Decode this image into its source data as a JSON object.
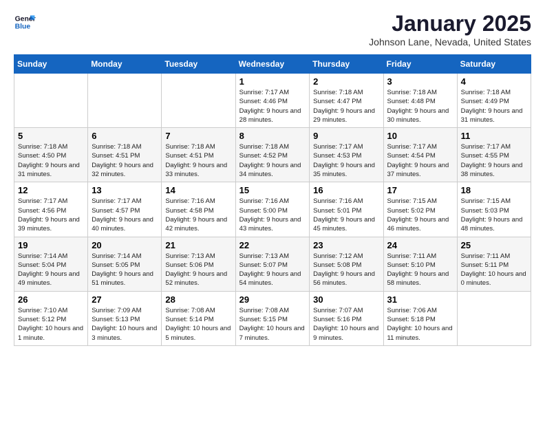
{
  "header": {
    "logo_line1": "General",
    "logo_line2": "Blue",
    "month": "January 2025",
    "location": "Johnson Lane, Nevada, United States"
  },
  "weekdays": [
    "Sunday",
    "Monday",
    "Tuesday",
    "Wednesday",
    "Thursday",
    "Friday",
    "Saturday"
  ],
  "weeks": [
    [
      {
        "day": "",
        "sunrise": "",
        "sunset": "",
        "daylight": ""
      },
      {
        "day": "",
        "sunrise": "",
        "sunset": "",
        "daylight": ""
      },
      {
        "day": "",
        "sunrise": "",
        "sunset": "",
        "daylight": ""
      },
      {
        "day": "1",
        "sunrise": "Sunrise: 7:17 AM",
        "sunset": "Sunset: 4:46 PM",
        "daylight": "Daylight: 9 hours and 28 minutes."
      },
      {
        "day": "2",
        "sunrise": "Sunrise: 7:18 AM",
        "sunset": "Sunset: 4:47 PM",
        "daylight": "Daylight: 9 hours and 29 minutes."
      },
      {
        "day": "3",
        "sunrise": "Sunrise: 7:18 AM",
        "sunset": "Sunset: 4:48 PM",
        "daylight": "Daylight: 9 hours and 30 minutes."
      },
      {
        "day": "4",
        "sunrise": "Sunrise: 7:18 AM",
        "sunset": "Sunset: 4:49 PM",
        "daylight": "Daylight: 9 hours and 31 minutes."
      }
    ],
    [
      {
        "day": "5",
        "sunrise": "Sunrise: 7:18 AM",
        "sunset": "Sunset: 4:50 PM",
        "daylight": "Daylight: 9 hours and 31 minutes."
      },
      {
        "day": "6",
        "sunrise": "Sunrise: 7:18 AM",
        "sunset": "Sunset: 4:51 PM",
        "daylight": "Daylight: 9 hours and 32 minutes."
      },
      {
        "day": "7",
        "sunrise": "Sunrise: 7:18 AM",
        "sunset": "Sunset: 4:51 PM",
        "daylight": "Daylight: 9 hours and 33 minutes."
      },
      {
        "day": "8",
        "sunrise": "Sunrise: 7:18 AM",
        "sunset": "Sunset: 4:52 PM",
        "daylight": "Daylight: 9 hours and 34 minutes."
      },
      {
        "day": "9",
        "sunrise": "Sunrise: 7:17 AM",
        "sunset": "Sunset: 4:53 PM",
        "daylight": "Daylight: 9 hours and 35 minutes."
      },
      {
        "day": "10",
        "sunrise": "Sunrise: 7:17 AM",
        "sunset": "Sunset: 4:54 PM",
        "daylight": "Daylight: 9 hours and 37 minutes."
      },
      {
        "day": "11",
        "sunrise": "Sunrise: 7:17 AM",
        "sunset": "Sunset: 4:55 PM",
        "daylight": "Daylight: 9 hours and 38 minutes."
      }
    ],
    [
      {
        "day": "12",
        "sunrise": "Sunrise: 7:17 AM",
        "sunset": "Sunset: 4:56 PM",
        "daylight": "Daylight: 9 hours and 39 minutes."
      },
      {
        "day": "13",
        "sunrise": "Sunrise: 7:17 AM",
        "sunset": "Sunset: 4:57 PM",
        "daylight": "Daylight: 9 hours and 40 minutes."
      },
      {
        "day": "14",
        "sunrise": "Sunrise: 7:16 AM",
        "sunset": "Sunset: 4:58 PM",
        "daylight": "Daylight: 9 hours and 42 minutes."
      },
      {
        "day": "15",
        "sunrise": "Sunrise: 7:16 AM",
        "sunset": "Sunset: 5:00 PM",
        "daylight": "Daylight: 9 hours and 43 minutes."
      },
      {
        "day": "16",
        "sunrise": "Sunrise: 7:16 AM",
        "sunset": "Sunset: 5:01 PM",
        "daylight": "Daylight: 9 hours and 45 minutes."
      },
      {
        "day": "17",
        "sunrise": "Sunrise: 7:15 AM",
        "sunset": "Sunset: 5:02 PM",
        "daylight": "Daylight: 9 hours and 46 minutes."
      },
      {
        "day": "18",
        "sunrise": "Sunrise: 7:15 AM",
        "sunset": "Sunset: 5:03 PM",
        "daylight": "Daylight: 9 hours and 48 minutes."
      }
    ],
    [
      {
        "day": "19",
        "sunrise": "Sunrise: 7:14 AM",
        "sunset": "Sunset: 5:04 PM",
        "daylight": "Daylight: 9 hours and 49 minutes."
      },
      {
        "day": "20",
        "sunrise": "Sunrise: 7:14 AM",
        "sunset": "Sunset: 5:05 PM",
        "daylight": "Daylight: 9 hours and 51 minutes."
      },
      {
        "day": "21",
        "sunrise": "Sunrise: 7:13 AM",
        "sunset": "Sunset: 5:06 PM",
        "daylight": "Daylight: 9 hours and 52 minutes."
      },
      {
        "day": "22",
        "sunrise": "Sunrise: 7:13 AM",
        "sunset": "Sunset: 5:07 PM",
        "daylight": "Daylight: 9 hours and 54 minutes."
      },
      {
        "day": "23",
        "sunrise": "Sunrise: 7:12 AM",
        "sunset": "Sunset: 5:08 PM",
        "daylight": "Daylight: 9 hours and 56 minutes."
      },
      {
        "day": "24",
        "sunrise": "Sunrise: 7:11 AM",
        "sunset": "Sunset: 5:10 PM",
        "daylight": "Daylight: 9 hours and 58 minutes."
      },
      {
        "day": "25",
        "sunrise": "Sunrise: 7:11 AM",
        "sunset": "Sunset: 5:11 PM",
        "daylight": "Daylight: 10 hours and 0 minutes."
      }
    ],
    [
      {
        "day": "26",
        "sunrise": "Sunrise: 7:10 AM",
        "sunset": "Sunset: 5:12 PM",
        "daylight": "Daylight: 10 hours and 1 minute."
      },
      {
        "day": "27",
        "sunrise": "Sunrise: 7:09 AM",
        "sunset": "Sunset: 5:13 PM",
        "daylight": "Daylight: 10 hours and 3 minutes."
      },
      {
        "day": "28",
        "sunrise": "Sunrise: 7:08 AM",
        "sunset": "Sunset: 5:14 PM",
        "daylight": "Daylight: 10 hours and 5 minutes."
      },
      {
        "day": "29",
        "sunrise": "Sunrise: 7:08 AM",
        "sunset": "Sunset: 5:15 PM",
        "daylight": "Daylight: 10 hours and 7 minutes."
      },
      {
        "day": "30",
        "sunrise": "Sunrise: 7:07 AM",
        "sunset": "Sunset: 5:16 PM",
        "daylight": "Daylight: 10 hours and 9 minutes."
      },
      {
        "day": "31",
        "sunrise": "Sunrise: 7:06 AM",
        "sunset": "Sunset: 5:18 PM",
        "daylight": "Daylight: 10 hours and 11 minutes."
      },
      {
        "day": "",
        "sunrise": "",
        "sunset": "",
        "daylight": ""
      }
    ]
  ]
}
